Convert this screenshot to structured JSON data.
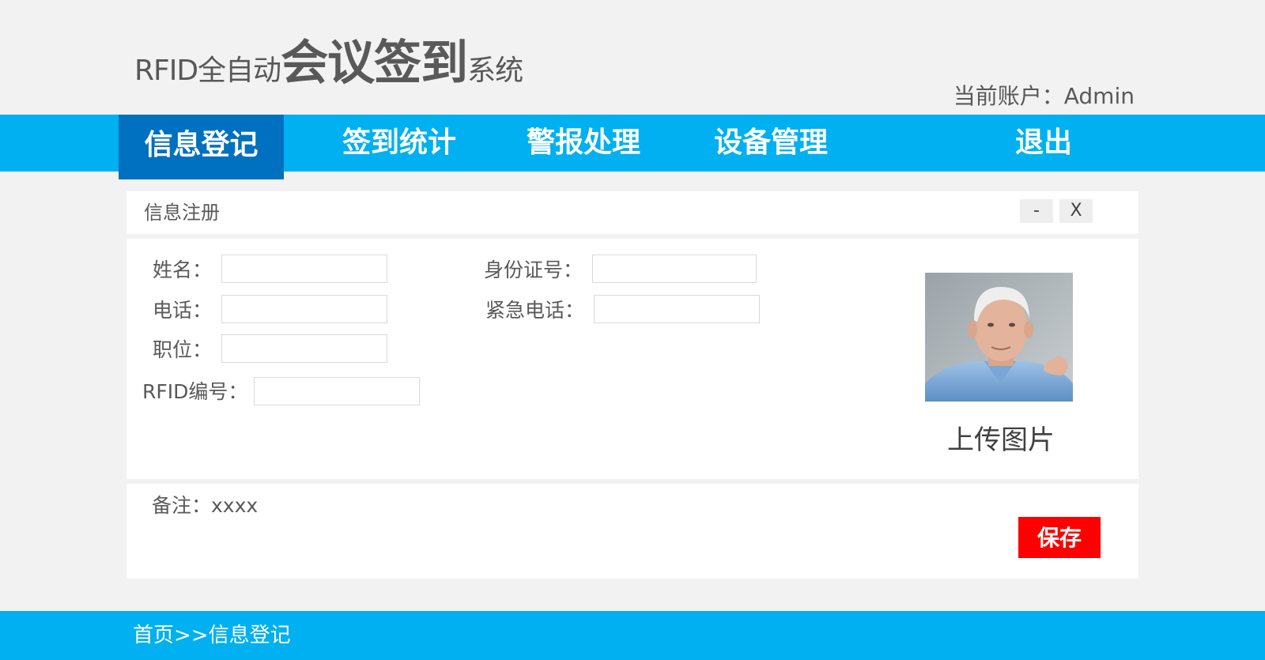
{
  "header": {
    "title_prefix": "RFID全自动",
    "title_main": "会议签到",
    "title_suffix": "系统",
    "account": "当前账户：Admin"
  },
  "nav": {
    "items": [
      {
        "label": "信息登记",
        "active": true
      },
      {
        "label": "签到统计"
      },
      {
        "label": "警报处理"
      },
      {
        "label": "设备管理"
      },
      {
        "label": "退出"
      }
    ]
  },
  "panel": {
    "title": "信息注册",
    "minimize_label": "-",
    "close_label": "X"
  },
  "form": {
    "name_label": "姓名：",
    "name_value": "",
    "phone_label": "电话：",
    "phone_value": "",
    "position_label": "职位：",
    "position_value": "",
    "rfid_label": "RFID编号：",
    "rfid_value": "",
    "id_label": "身份证号：",
    "id_value": "",
    "emergency_label": "紧急电话：",
    "emergency_value": ""
  },
  "photo": {
    "upload_label": "上传图片"
  },
  "footer_panel": {
    "remark": "备注：xxxx",
    "save_label": "保存"
  },
  "breadcrumb": "首页>>信息登记",
  "colors": {
    "nav_bg": "#00b0f0",
    "nav_active": "#0070c0",
    "save": "#ff0000",
    "page_bg": "#f2f2f2"
  }
}
